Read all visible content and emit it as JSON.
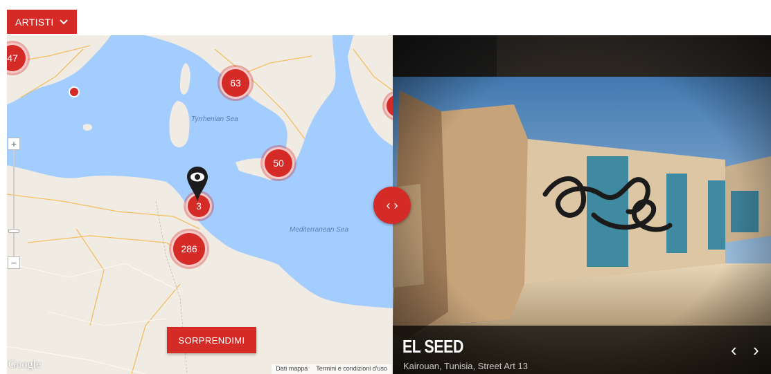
{
  "header": {
    "filter_label": "ARTISTI"
  },
  "map": {
    "sea_labels": {
      "tyrrhenian": "Tyrrhenian Sea",
      "mediterranean": "Mediterranean Sea"
    },
    "clusters": [
      {
        "id": "c47",
        "count": "47"
      },
      {
        "id": "c63",
        "count": "63"
      },
      {
        "id": "c50",
        "count": "50"
      },
      {
        "id": "c3",
        "count": "3"
      },
      {
        "id": "c286",
        "count": "286"
      }
    ],
    "zoom": {
      "in": "+",
      "out": "−"
    },
    "surprise_label": "SORPRENDIMI",
    "attribution": {
      "logo": "Google",
      "data": "Dati mappa",
      "terms": "Termini e condizioni d'uso"
    }
  },
  "toggle": {
    "left": "‹",
    "right": "›"
  },
  "photo": {
    "title": "EL SEED",
    "subtitle": "Kairouan, Tunisia, Street Art 13",
    "prev": "‹",
    "next": "›"
  },
  "colors": {
    "accent": "#d52b27",
    "sea": "#a3ccff",
    "land": "#f1ece3"
  }
}
